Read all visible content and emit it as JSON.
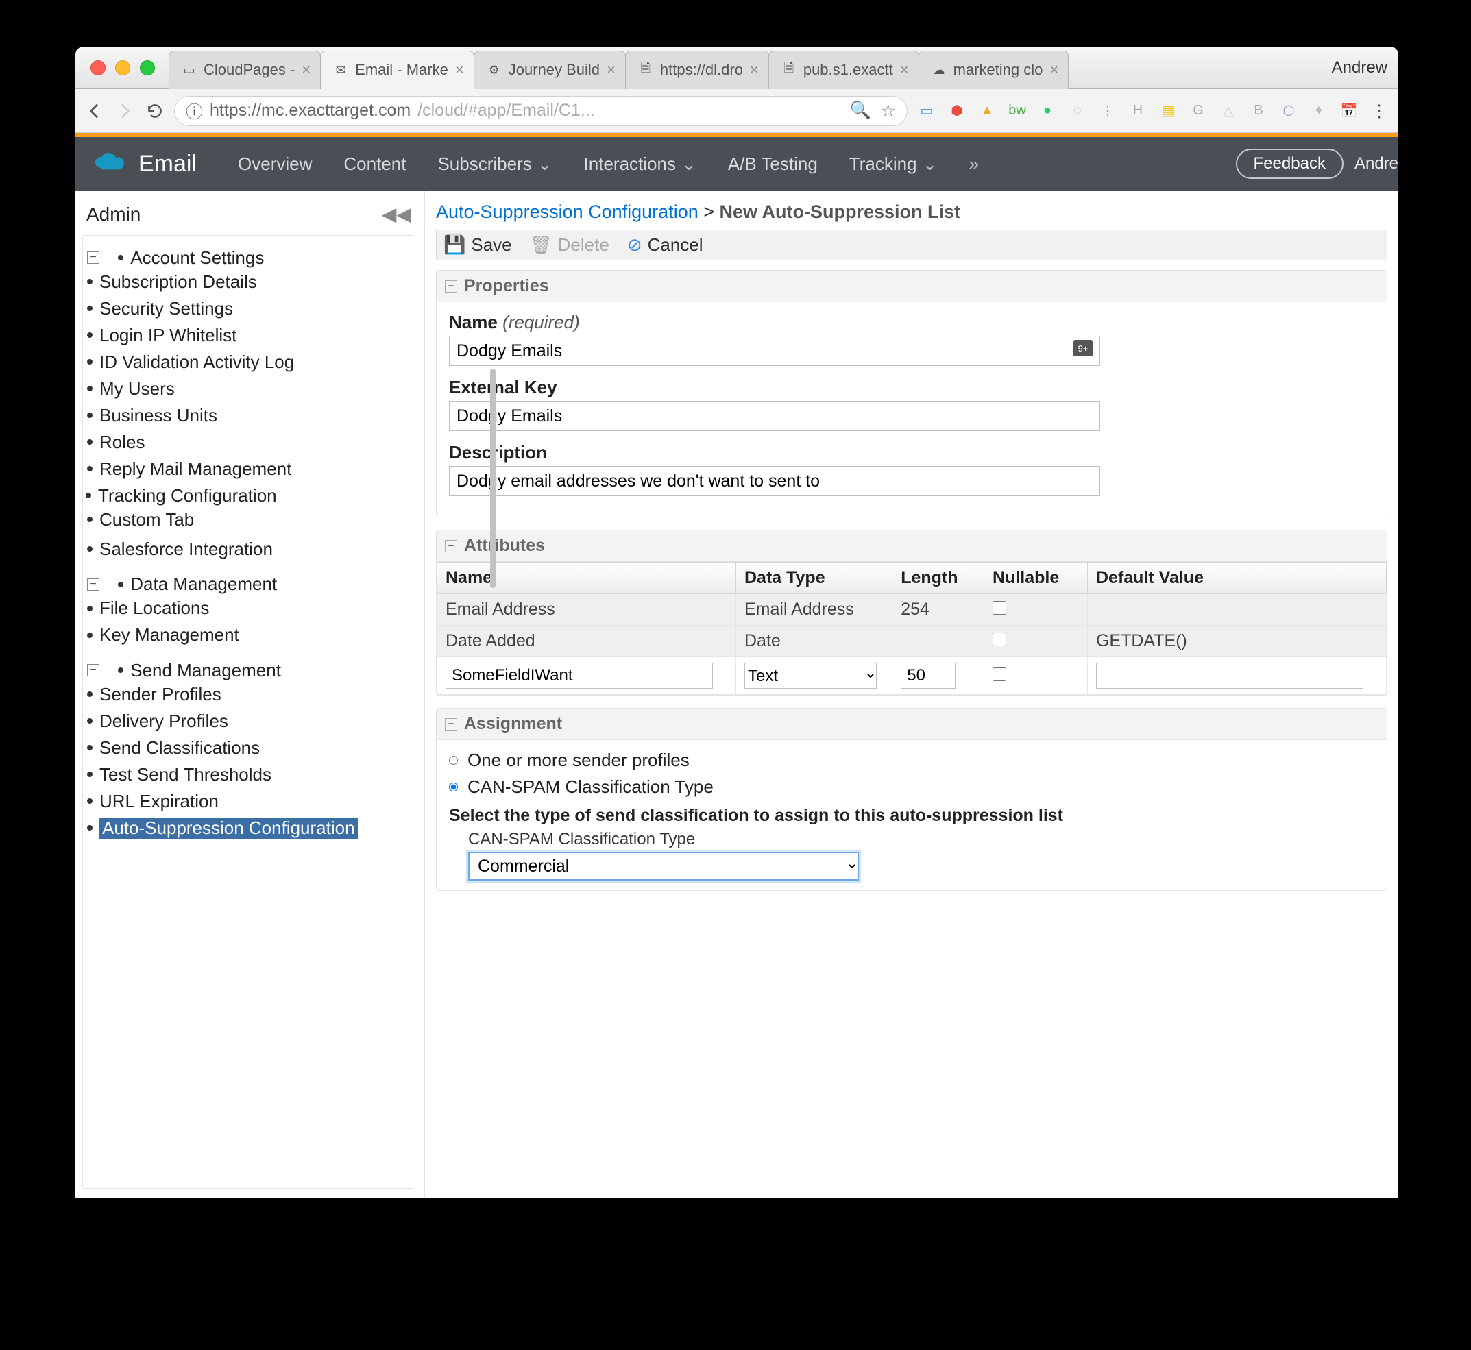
{
  "browser": {
    "user": "Andrew",
    "tabs": [
      {
        "label": "CloudPages - "
      },
      {
        "label": "Email - Marke",
        "active": true
      },
      {
        "label": "Journey Build"
      },
      {
        "label": "https://dl.dro"
      },
      {
        "label": "pub.s1.exactt"
      },
      {
        "label": "marketing clo"
      }
    ],
    "url_host": "https://mc.exacttarget.com",
    "url_path": "/cloud/#app/Email/C1..."
  },
  "appnav": {
    "app": "Email",
    "items": [
      "Overview",
      "Content",
      "Subscribers",
      "Interactions",
      "A/B Testing",
      "Tracking"
    ],
    "feedback": "Feedback",
    "user": "Andre"
  },
  "sidebar": {
    "title": "Admin",
    "groups": [
      {
        "label": "Account Settings",
        "children": [
          "Subscription Details",
          "Security Settings",
          "Login IP Whitelist",
          "ID Validation Activity Log",
          "My Users",
          "Business Units",
          "Roles",
          "Reply Mail Management"
        ],
        "subgroup": {
          "label": "Tracking Configuration",
          "children": [
            "Custom Tab"
          ]
        },
        "tail": [
          "Salesforce Integration"
        ]
      },
      {
        "label": "Data Management",
        "children": [
          "File Locations",
          "Key Management"
        ]
      },
      {
        "label": "Send Management",
        "children": [
          "Sender Profiles",
          "Delivery Profiles",
          "Send Classifications",
          "Test Send Thresholds",
          "URL Expiration",
          "Auto-Suppression Configuration"
        ],
        "selected": "Auto-Suppression Configuration"
      }
    ]
  },
  "crumb": {
    "parent": "Auto-Suppression Configuration",
    "current": "New Auto-Suppression List"
  },
  "toolbar": {
    "save": "Save",
    "delete": "Delete",
    "cancel": "Cancel"
  },
  "sections": {
    "properties": "Properties",
    "attributes": "Attributes",
    "assignment": "Assignment"
  },
  "properties": {
    "name_label": "Name",
    "name_req": "(required)",
    "name_value": "Dodgy Emails",
    "extkey_label": "External Key",
    "extkey_value": "Dodgy Emails",
    "desc_label": "Description",
    "desc_value": "Dodgy email addresses we don't want to sent to"
  },
  "attributes": {
    "headers": [
      "Name",
      "Data Type",
      "Length",
      "Nullable",
      "Default Value"
    ],
    "rows": [
      {
        "name": "Email Address",
        "type": "Email Address",
        "length": "254",
        "nullable": false,
        "default": ""
      },
      {
        "name": "Date Added",
        "type": "Date",
        "length": "",
        "nullable": false,
        "default": "GETDATE()"
      }
    ],
    "editrow": {
      "name": "SomeFieldIWant",
      "type": "Text",
      "length": "50",
      "nullable": false,
      "default": ""
    }
  },
  "assignment": {
    "opt1": "One or more sender profiles",
    "opt2": "CAN-SPAM Classification Type",
    "heading": "Select the type of send classification to assign to this auto-suppression list",
    "sub_label": "CAN-SPAM Classification Type",
    "sub_value": "Commercial"
  }
}
